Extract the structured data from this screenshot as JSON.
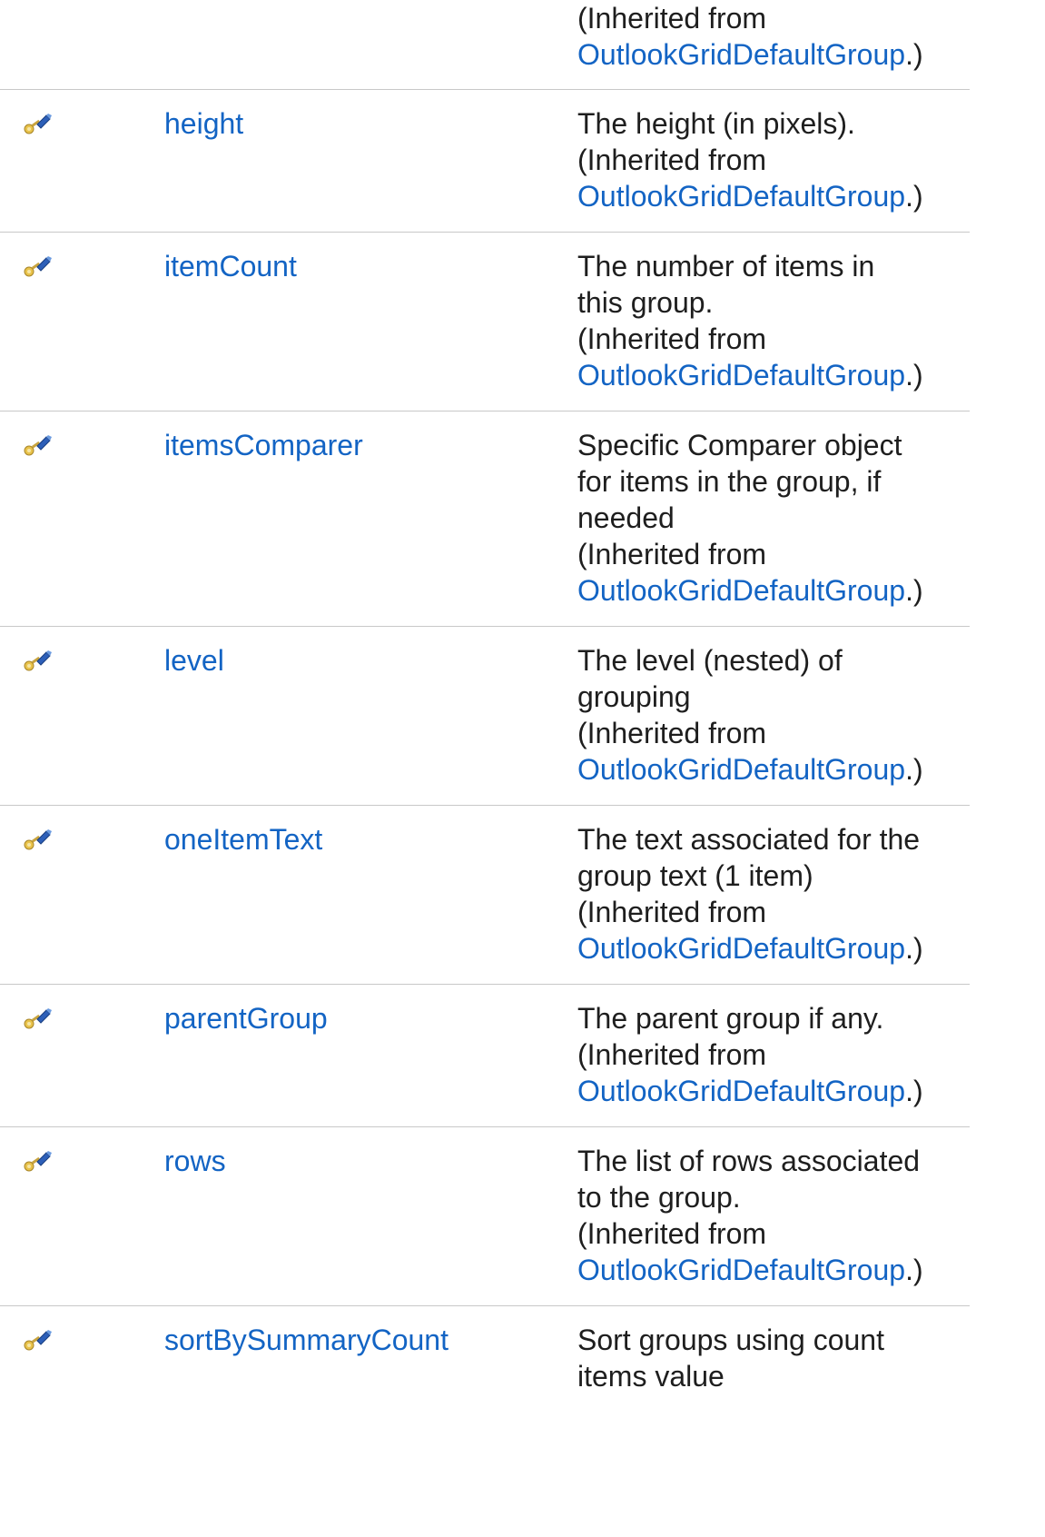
{
  "colors": {
    "link": "#1364c4",
    "text": "#1e1e1e",
    "divider": "#c8c8c8"
  },
  "icon_name": "protected-field-icon",
  "inherited_prefix": "(Inherited from",
  "inherited_class": "OutlookGridDefaultGroup",
  "inherited_suffix": ".)",
  "rows": [
    {
      "name": "",
      "has_icon": false,
      "description_lines": []
    },
    {
      "name": "height",
      "has_icon": true,
      "description_lines": [
        "The height (in pixels)."
      ]
    },
    {
      "name": "itemCount",
      "has_icon": true,
      "description_lines": [
        "The number of items in",
        "this group."
      ]
    },
    {
      "name": "itemsComparer",
      "has_icon": true,
      "description_lines": [
        "Specific Comparer object",
        "for items in the group, if",
        "needed"
      ]
    },
    {
      "name": "level",
      "has_icon": true,
      "description_lines": [
        "The level (nested) of",
        "grouping"
      ]
    },
    {
      "name": "oneItemText",
      "has_icon": true,
      "description_lines": [
        "The text associated for the",
        "group text (1 item)"
      ]
    },
    {
      "name": "parentGroup",
      "has_icon": true,
      "description_lines": [
        "The parent group if any."
      ]
    },
    {
      "name": "rows",
      "has_icon": true,
      "description_lines": [
        "The list of rows associated",
        "to the group."
      ]
    },
    {
      "name": "sortBySummaryCount",
      "has_icon": true,
      "description_lines": [
        "Sort groups using count",
        "items value"
      ],
      "truncated": true
    }
  ]
}
